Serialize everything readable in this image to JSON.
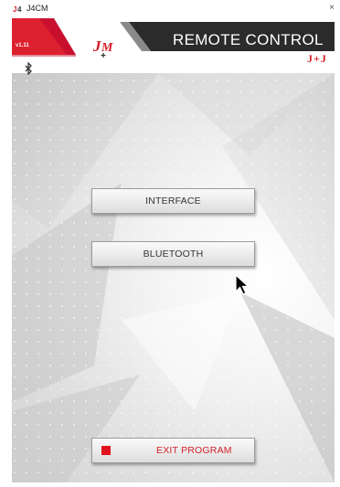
{
  "window": {
    "title": "J4CM",
    "app_icon": "jm-logo-icon",
    "close_glyph": "×"
  },
  "header": {
    "version": "v1.11",
    "title": "REMOTE CONTROL",
    "brand": "J+J",
    "logo": "jm-logo",
    "status_icon": "bluetooth-icon"
  },
  "buttons": {
    "interface": "INTERFACE",
    "bluetooth": "BLUETOOTH",
    "exit": "EXIT PROGRAM"
  },
  "colors": {
    "accent_red": "#d4202b",
    "header_dark": "#2b2b2b",
    "button_face": "#ececec"
  }
}
